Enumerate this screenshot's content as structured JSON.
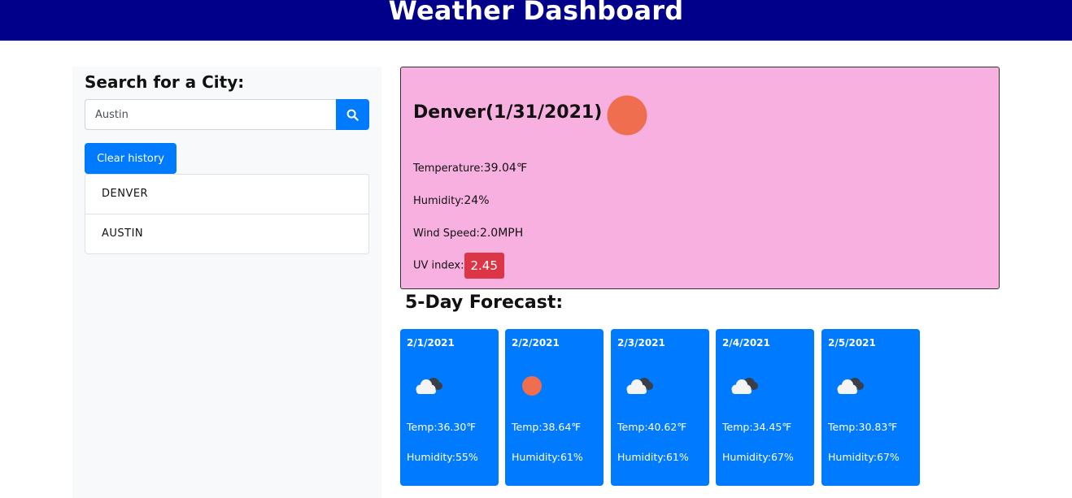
{
  "header": {
    "title": "Weather Dashboard"
  },
  "sidebar": {
    "heading": "Search for a City:",
    "search_value": "Austin",
    "search_icon": "search-icon",
    "clear_label": "Clear history",
    "history": [
      "DENVER",
      "AUSTIN"
    ]
  },
  "current": {
    "title": "Denver(1/31/2021)",
    "icon": "sun-icon",
    "temperature_label": "Temperature:",
    "temperature_value": "39.04℉",
    "humidity_label": "Humidity:",
    "humidity_value": "24%",
    "wind_label": "Wind Speed:",
    "wind_value": "2.0MPH",
    "uv_label": "UV index:",
    "uv_value": "2.45"
  },
  "forecast": {
    "title": "5-Day Forecast:",
    "days": [
      {
        "date": "2/1/2021",
        "icon": "cloud-icon",
        "temp": "Temp:36.30℉",
        "humidity": "Humidity:55%"
      },
      {
        "date": "2/2/2021",
        "icon": "sun-icon",
        "temp": "Temp:38.64℉",
        "humidity": "Humidity:61%"
      },
      {
        "date": "2/3/2021",
        "icon": "cloud-icon",
        "temp": "Temp:40.62℉",
        "humidity": "Humidity:61%"
      },
      {
        "date": "2/4/2021",
        "icon": "cloud-icon",
        "temp": "Temp:34.45℉",
        "humidity": "Humidity:67%"
      },
      {
        "date": "2/5/2021",
        "icon": "cloud-icon",
        "temp": "Temp:30.83℉",
        "humidity": "Humidity:67%"
      }
    ]
  },
  "colors": {
    "header_bg": "#00008b",
    "primary": "#007bff",
    "current_bg": "#f7b0e0",
    "uv_badge": "#dc3545",
    "sun": "#ee6e4f"
  }
}
